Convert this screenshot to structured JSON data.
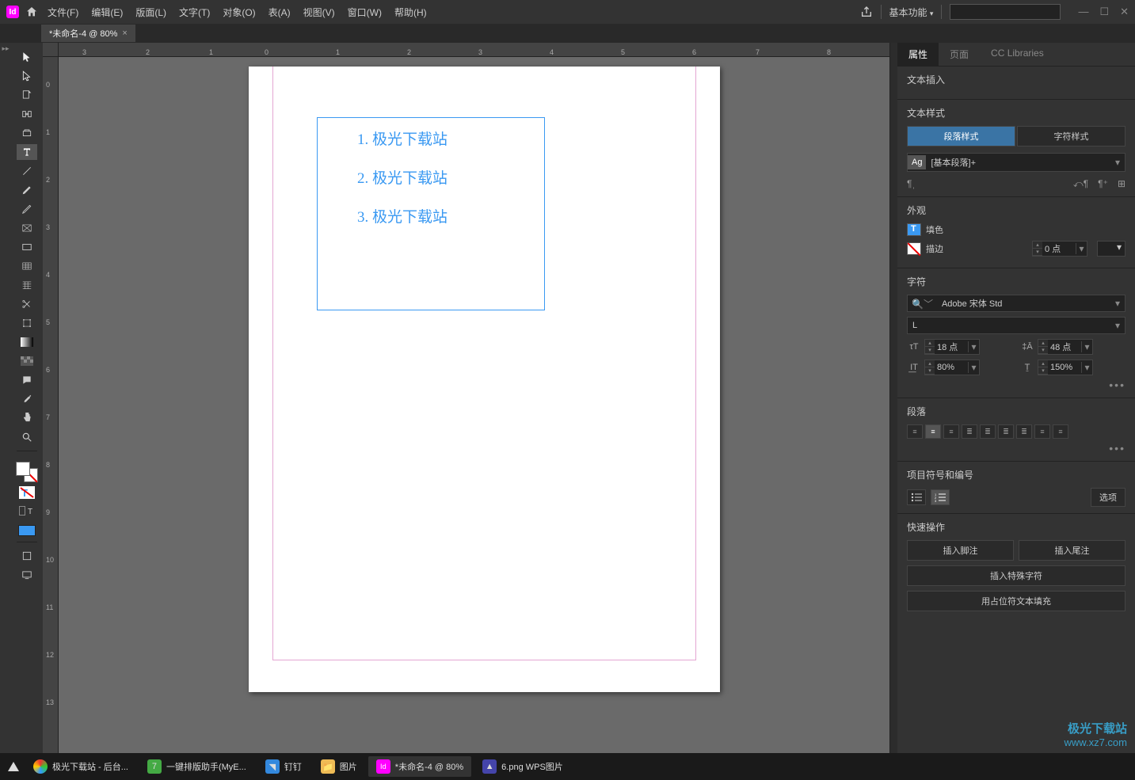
{
  "menubar": {
    "file": "文件(F)",
    "edit": "编辑(E)",
    "layout": "版面(L)",
    "text": "文字(T)",
    "object": "对象(O)",
    "table": "表(A)",
    "view": "视图(V)",
    "window": "窗口(W)",
    "help": "帮助(H)",
    "workspace": "基本功能"
  },
  "doc_tab": {
    "label": "*未命名-4 @ 80%",
    "close": "×"
  },
  "canvas": {
    "lines": [
      "1.  极光下载站",
      "2.  极光下载站",
      "3.  极光下载站"
    ]
  },
  "panel": {
    "tabs": {
      "props": "属性",
      "pages": "页面",
      "cc": "CC Libraries"
    },
    "text_insert": "文本插入",
    "text_style": "文本样式",
    "para_style_btn": "段落样式",
    "char_style_btn": "字符样式",
    "style_name": "[基本段落]+",
    "appearance": "外观",
    "fill": "填色",
    "stroke": "描边",
    "stroke_val": "0 点",
    "char": "字符",
    "font_family": "Adobe 宋体 Std",
    "font_style": "L",
    "font_size": "18 点",
    "leading": "48 点",
    "tracking": "80%",
    "kerning": "150%",
    "para": "段落",
    "bullets": "项目符号和编号",
    "options": "选项",
    "quick": "快速操作",
    "insert_footnote": "插入脚注",
    "insert_endnote": "插入尾注",
    "insert_special": "插入特殊字符",
    "fill_placeholder": "用占位符文本填充"
  },
  "taskbar": {
    "t1": "极光下载站 - 后台...",
    "t2": "一键排版助手(MyE...",
    "t3": "钉钉",
    "t4": "图片",
    "t5": "*未命名-4 @ 80%",
    "t6": "6.png  WPS图片"
  },
  "watermark": {
    "brand": "极光下载站",
    "url": "www.xz7.com"
  }
}
